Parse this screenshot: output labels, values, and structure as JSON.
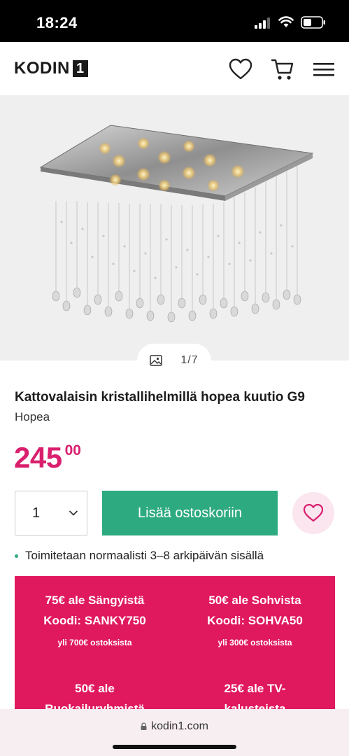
{
  "status_bar": {
    "time": "18:24"
  },
  "header": {
    "logo_text": "KODIN",
    "logo_box": "1",
    "icons": [
      "heart-icon",
      "cart-icon",
      "menu-icon"
    ]
  },
  "gallery": {
    "counter": "1/7"
  },
  "product": {
    "title": "Kattovalaisin kristallihelmillä hopea kuutio G9",
    "variant": "Hopea",
    "price_main": "245",
    "price_cents": "00"
  },
  "buy": {
    "quantity": "1",
    "add_to_cart": "Lisää ostoskoriin"
  },
  "delivery_text": "Toimitetaan normaalisti 3–8 arkipäivän sisällä",
  "promos": [
    {
      "line1": "75€ ale Sängyistä",
      "line2": "Koodi: SANKY750",
      "line3": "yli 700€ ostoksista"
    },
    {
      "line1": "50€ ale Sohvista",
      "line2": "Koodi: SOHVA50",
      "line3": "yli 300€ ostoksista"
    },
    {
      "line1": "50€ ale",
      "line2": "Ruokailuryhmistä",
      "line3": ""
    },
    {
      "line1": "25€ ale TV-",
      "line2": "kalusteista",
      "line3": ""
    }
  ],
  "browser": {
    "url": "kodin1.com"
  },
  "colors": {
    "accent": "#e0195f",
    "price": "#d91f6e",
    "cta": "#2eaa81"
  }
}
